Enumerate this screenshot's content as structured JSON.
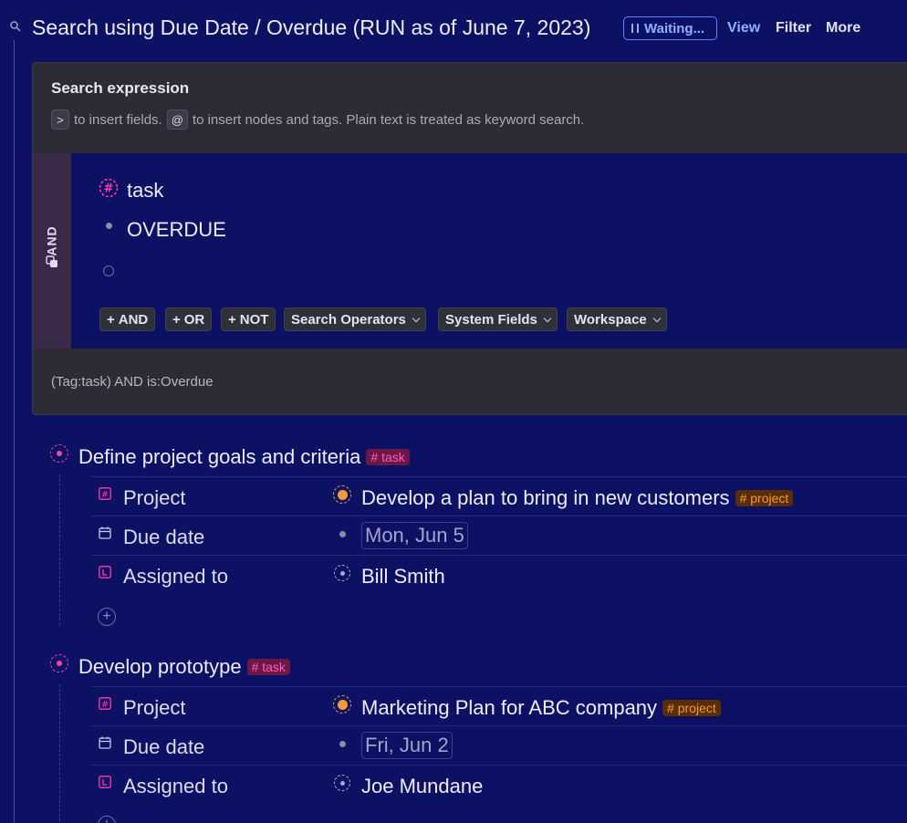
{
  "header": {
    "title": "Search using Due Date / Overdue (RUN as of June 7, 2023)",
    "waiting_label": "Waiting...",
    "view_label": "View",
    "filter_label": "Filter",
    "more_label": "More"
  },
  "panel": {
    "title": "Search expression",
    "hint": {
      "key1": ">",
      "text1": "to insert fields.",
      "key2": "@",
      "text2": "to insert nodes and tags. Plain text is treated as keyword search."
    },
    "group_label": "AND",
    "expressions": [
      "task",
      "OVERDUE"
    ],
    "operators": {
      "and": "AND",
      "or": "OR",
      "not": "NOT",
      "search_operators": "Search Operators",
      "system_fields": "System Fields",
      "workspace": "Workspace"
    },
    "query": "(Tag:task) AND is:Overdue"
  },
  "results": [
    {
      "title": "Define project goals and criteria",
      "tag": "task",
      "fields": [
        {
          "label": "Project",
          "value": "Develop a plan to bring in new customers",
          "tag": "project"
        },
        {
          "label": "Due date",
          "value": "Mon, Jun 5"
        },
        {
          "label": "Assigned to",
          "value": "Bill Smith"
        }
      ]
    },
    {
      "title": "Develop prototype",
      "tag": "task",
      "fields": [
        {
          "label": "Project",
          "value": "Marketing Plan for ABC company",
          "tag": "project"
        },
        {
          "label": "Due date",
          "value": "Fri, Jun 2"
        },
        {
          "label": "Assigned to",
          "value": "Joe Mundane"
        }
      ]
    }
  ],
  "colors": {
    "background": "#0d1163",
    "panel": "#2b2c36",
    "task_tag": "#ff5eb7",
    "project_tag": "#f39a3c",
    "link": "#8fb0ff"
  }
}
